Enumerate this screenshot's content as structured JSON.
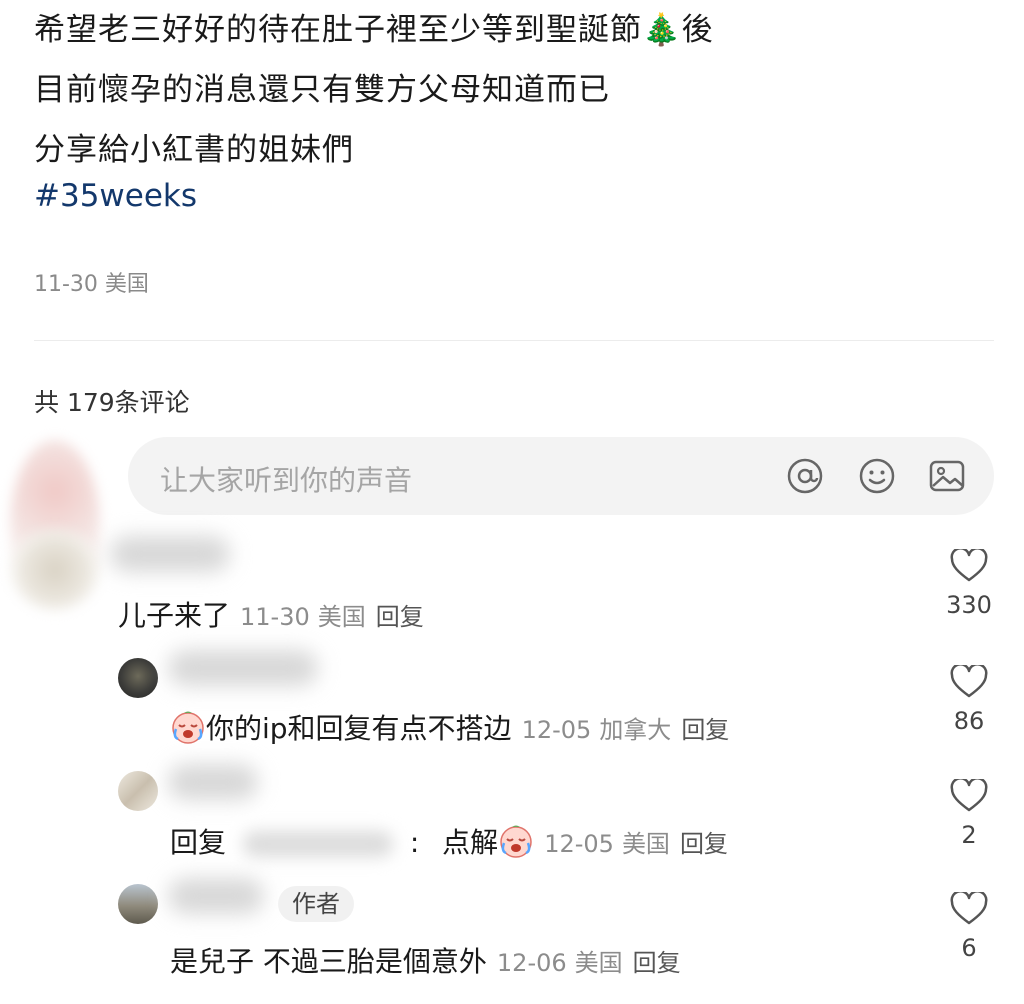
{
  "post": {
    "lines": [
      "希望老三好好的待在肚子裡至少等到聖誕節🎄後",
      "目前懷孕的消息還只有雙方父母知道而已",
      "分享給小紅書的姐妹們"
    ],
    "hashtag": "#35weeks",
    "meta": "11-30 美国"
  },
  "comments_header": "共 179条评论",
  "input": {
    "placeholder": "让大家听到你的声音",
    "icons": [
      "at-icon",
      "emoji-icon",
      "image-icon"
    ]
  },
  "comments": [
    {
      "text": "儿子来了",
      "date": "11-30",
      "location": "美国",
      "reply": "回复",
      "likes": "330"
    },
    {
      "text": "你的ip和回复有点不搭边",
      "date": "12-05",
      "location": "加拿大",
      "reply": "回复",
      "likes": "86"
    },
    {
      "prefix": "回复",
      "colon": ":",
      "text": "点解",
      "date": "12-05",
      "location": "美国",
      "reply": "回复",
      "likes": "2"
    },
    {
      "badge": "作者",
      "text": "是兒子 不過三胎是個意外",
      "date": "12-06",
      "location": "美国",
      "reply": "回复",
      "likes": "6"
    }
  ],
  "colors": {
    "hashtag": "#13386c",
    "meta": "#8c8c8c",
    "input_bg": "#f3f3f3"
  }
}
